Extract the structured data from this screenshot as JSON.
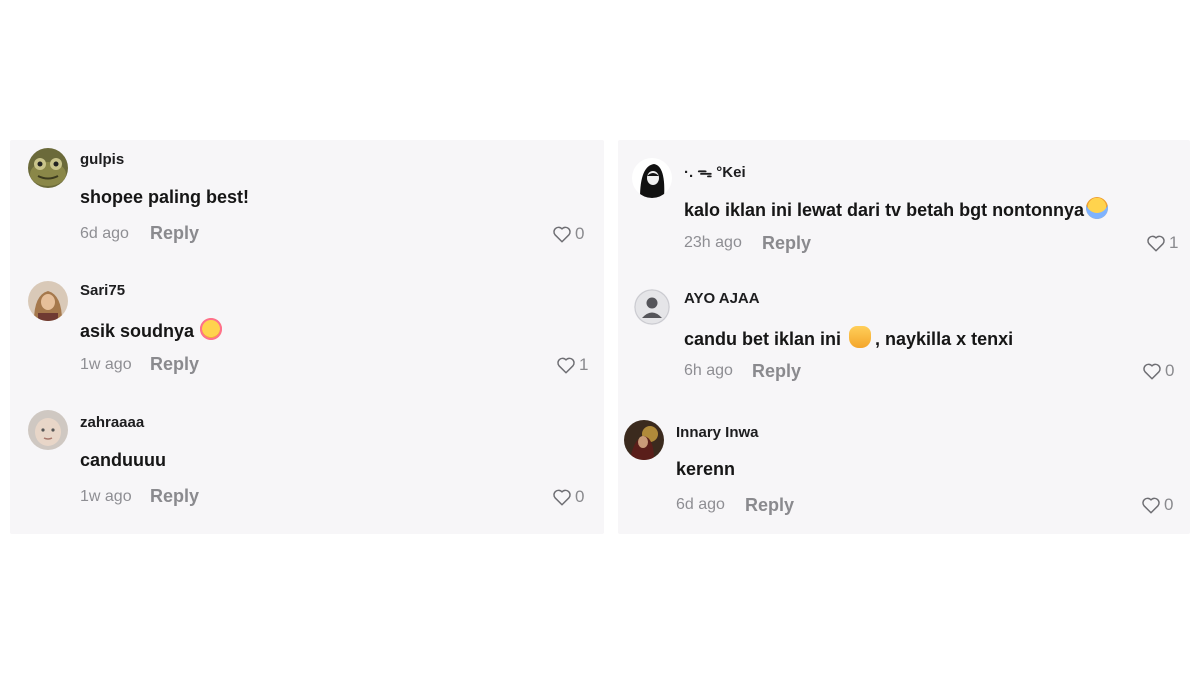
{
  "left_panel": {
    "comments": [
      {
        "username": "gulpis",
        "text": "shopee paling best!",
        "time": "6d ago",
        "reply": "Reply",
        "likes": "0",
        "avatar_icon": "frog-avatar-icon"
      },
      {
        "username": "Sari75",
        "text": "asik soudnya",
        "emoji": "smiling-face-with-hearts",
        "time": "1w ago",
        "reply": "Reply",
        "likes": "1",
        "avatar_icon": "woman-hijab-avatar-icon"
      },
      {
        "username": "zahraaaa",
        "text": "canduuuu",
        "time": "1w ago",
        "reply": "Reply",
        "likes": "0",
        "avatar_icon": "baby-avatar-icon"
      }
    ]
  },
  "right_panel": {
    "comments": [
      {
        "username": "·. ᯓ °Kei",
        "text": "kalo iklan ini lewat dari tv betah bgt nontonnya",
        "emoji": "crying-face",
        "time": "23h ago",
        "reply": "Reply",
        "likes": "1",
        "avatar_icon": "hooded-figure-avatar-icon"
      },
      {
        "username": "AYO AJAA",
        "text_before": "candu bet iklan ini",
        "text_after": ", naykilla x tenxi",
        "emoji": "hand-gesture",
        "time": "6h ago",
        "reply": "Reply",
        "likes": "0",
        "avatar_icon": "default-avatar-icon"
      },
      {
        "username": "Innary Inwa",
        "text": "kerenn",
        "time": "6d ago",
        "reply": "Reply",
        "likes": "0",
        "avatar_icon": "photo-avatar-icon"
      }
    ]
  },
  "colors": {
    "panel_bg": "#f7f6f8",
    "text_primary": "#161616",
    "text_secondary": "#8e8e93"
  }
}
